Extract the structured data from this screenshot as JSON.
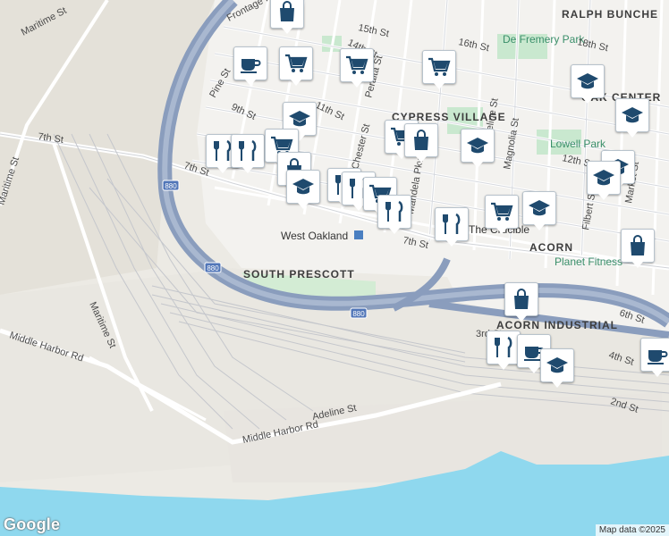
{
  "map": {
    "neighborhoods": [
      "RALPH BUNCHE",
      "OAK CENTER",
      "CYPRESS VILLAGE",
      "SOUTH PRESCOTT",
      "ACORN",
      "ACORN INDUSTRIAL"
    ],
    "parks": [
      "De Fremery Park",
      "Lowell Park"
    ],
    "places": [
      "Planet Fitness",
      "The Crucible"
    ],
    "station": "West Oakland",
    "highway_shield": "880",
    "streets": {
      "frontage": "Frontage Rd",
      "maritime_1": "Maritime St",
      "maritime_2": "Maritime St",
      "maritime_3": "Maritime St",
      "seventh_1": "7th St",
      "seventh_2": "7th St",
      "seventh_3": "7th St",
      "pine": "Pine St",
      "ninth": "9th St",
      "eleventh": "11th St",
      "fourteenth": "14th St",
      "fifteenth": "15th St",
      "sixteenth": "16th St",
      "eighteenth": "18th St",
      "peralta": "Peralta St",
      "chester": "Chester St",
      "mandela": "Mandela Pkwy",
      "magnolia": "Magnolia St",
      "adeline_n": "Adeline St",
      "adeline_s": "Adeline St",
      "filbert": "Filbert St",
      "market": "Market St",
      "twelfth": "12th St",
      "sixth": "6th St",
      "fourth": "4th St",
      "second": "2nd St",
      "third": "3rd St",
      "middle_harbor_1": "Middle Harbor Rd",
      "middle_harbor_2": "Middle Harbor Rd"
    },
    "attribution": "Map data ©2025",
    "logo": "Google",
    "colors": {
      "water": "#8fd8ee",
      "highway": "#8a9dbd",
      "park": "#c9e8cf",
      "marker_icon": "#1f4a6e",
      "land": "#eceae4"
    }
  }
}
